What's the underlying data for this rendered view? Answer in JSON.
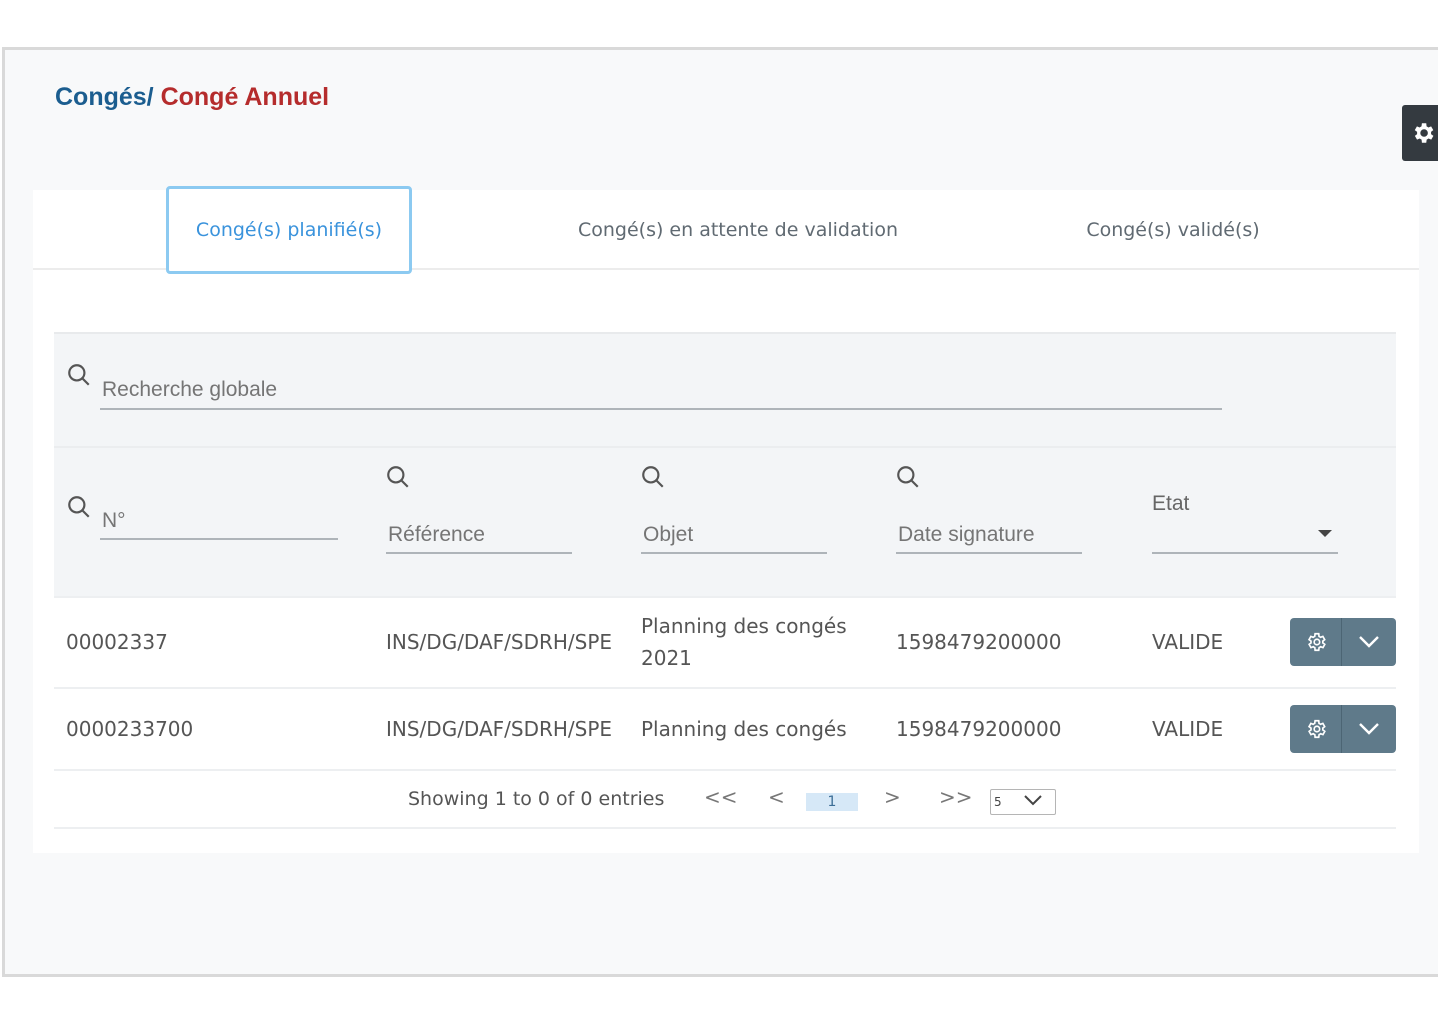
{
  "breadcrumb": {
    "parent": "Congés/",
    "current": "Congé Annuel"
  },
  "tabs": [
    {
      "label": "Congé(s) planifié(s)",
      "active": true
    },
    {
      "label": "Congé(s) en attente de validation",
      "active": false
    },
    {
      "label": "Congé(s) validé(s)",
      "active": false
    }
  ],
  "search": {
    "placeholder": "Recherche globale"
  },
  "filters": {
    "num_placeholder": "N°",
    "ref_placeholder": "Référence",
    "obj_placeholder": "Objet",
    "date_placeholder": "Date signature",
    "etat_label": "Etat"
  },
  "rows": [
    {
      "num": "00002337",
      "ref": "INS/DG/DAF/SDRH/SPE",
      "obj_line1": "Planning des congés",
      "obj_line2": "2021",
      "date": "1598479200000",
      "etat": "VALIDE"
    },
    {
      "num": "0000233700",
      "ref": "INS/DG/DAF/SDRH/SPE",
      "obj_line1": "Planning des congés",
      "date": "1598479200000",
      "etat": "VALIDE"
    }
  ],
  "paginator": {
    "info": "Showing 1 to 0 of 0 entries",
    "first": "<<",
    "prev": "<",
    "current": "1",
    "next": ">",
    "last": ">>",
    "page_size": "5"
  },
  "colors": {
    "blue_title": "#1b5d8f",
    "red_title": "#b52c2c",
    "active_tab": "#3a93dc",
    "action_btn": "#5f7a8a"
  },
  "icons": [
    "settings-gear-icon",
    "search-icon",
    "caret-down-icon",
    "chevron-down-icon"
  ]
}
